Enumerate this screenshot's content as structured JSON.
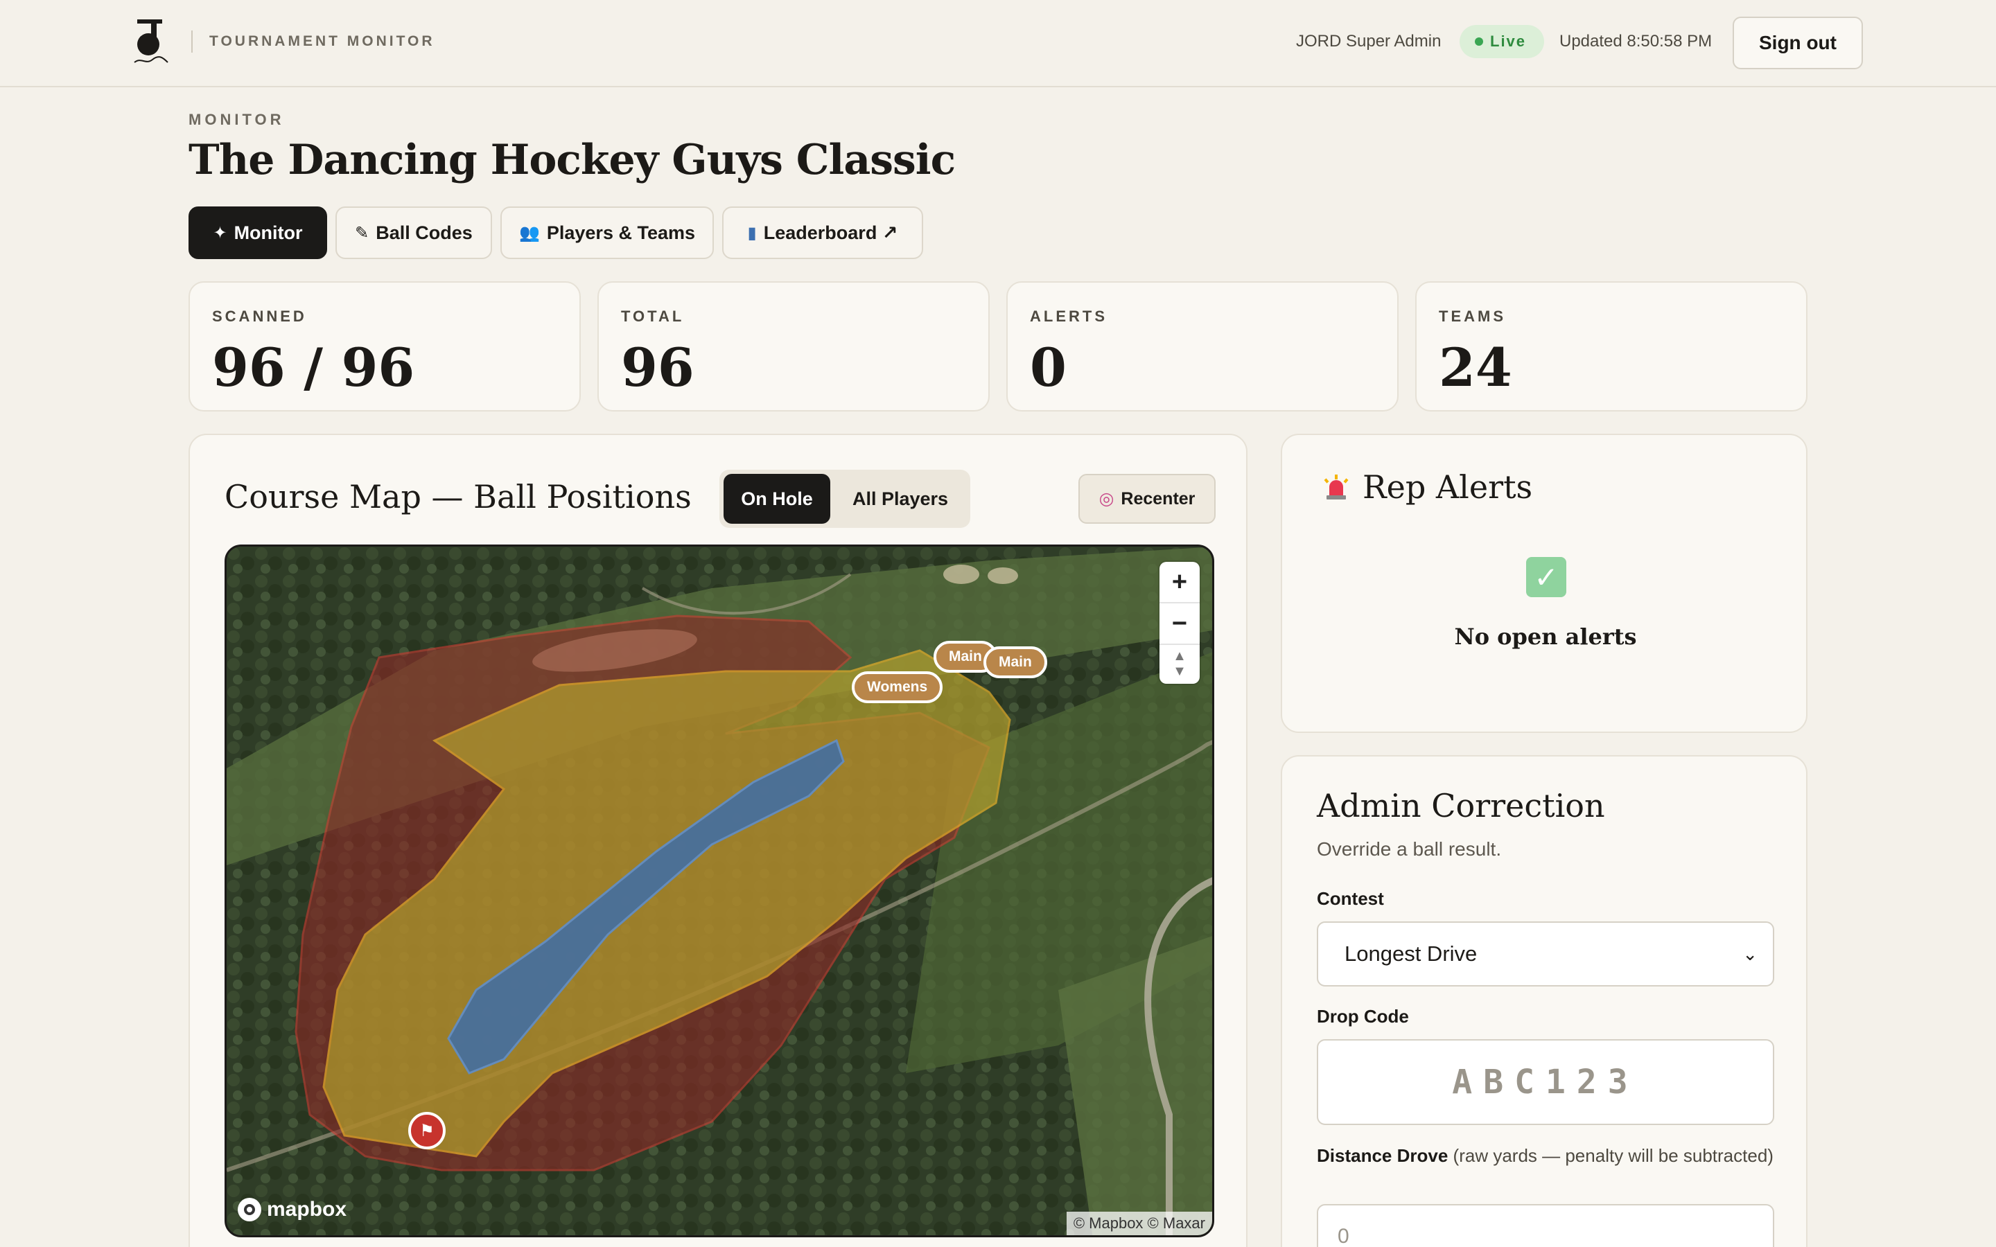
{
  "header": {
    "brand": "TOURNAMENT MONITOR",
    "admin_name": "JORD Super Admin",
    "live_label": "Live",
    "updated": "Updated 8:50:58 PM",
    "sign_out": "Sign out"
  },
  "page": {
    "eyebrow": "MONITOR",
    "title": "The Dancing Hockey Guys Classic"
  },
  "tabs": [
    {
      "label": "Monitor",
      "icon": "magic-wand-icon",
      "active": true
    },
    {
      "label": "Ball Codes",
      "icon": "pencil-icon",
      "active": false
    },
    {
      "label": "Players & Teams",
      "icon": "people-icon",
      "active": false
    },
    {
      "label": "Leaderboard ↗",
      "icon": "bar-chart-icon",
      "active": false
    }
  ],
  "stats": [
    {
      "label": "SCANNED",
      "value": "96 / 96"
    },
    {
      "label": "TOTAL",
      "value": "96"
    },
    {
      "label": "ALERTS",
      "value": "0"
    },
    {
      "label": "TEAMS",
      "value": "24"
    }
  ],
  "map_card": {
    "title": "Course Map — Ball Positions",
    "toggle": [
      "On Hole",
      "All Players"
    ],
    "toggle_selected": "On Hole",
    "recenter": "Recenter",
    "zoom_in": "+",
    "zoom_out": "−",
    "compass": "▲▼",
    "markers": [
      "Main",
      "Main",
      "Womens"
    ],
    "mapbox_logo": "mapbox",
    "attribution": "© Mapbox © Maxar",
    "zone_colors": {
      "outer": "#9e3a36",
      "middle": "#b5a132",
      "inner": "#3d6fa8"
    }
  },
  "alerts_card": {
    "title": "Rep Alerts",
    "empty_text": "No open alerts"
  },
  "admin_card": {
    "title": "Admin Correction",
    "subtitle": "Override a ball result.",
    "contest_label": "Contest",
    "contest_value": "Longest Drive",
    "drop_code_label": "Drop Code",
    "drop_code_placeholder": "ABC123",
    "distance_label": "Distance Drove",
    "distance_hint": "(raw yards — penalty will be subtracted)",
    "distance_placeholder": "0"
  }
}
